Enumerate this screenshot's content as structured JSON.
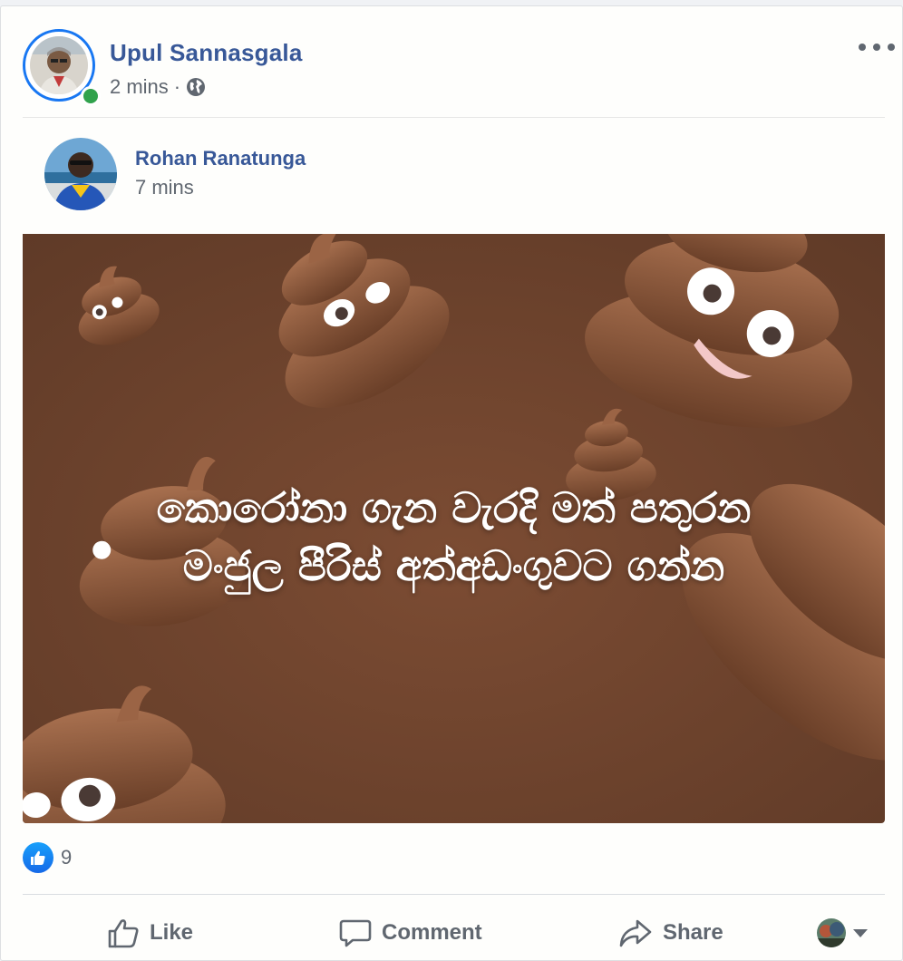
{
  "post": {
    "author": "Upul Sannasgala",
    "time": "2 mins",
    "separator": "·",
    "privacy_icon": "globe-icon",
    "online": true
  },
  "shared_post": {
    "author": "Rohan Ranatunga",
    "time": "7 mins",
    "image_caption_line1": "කොරෝනා ගැන වැරදි මත් පතුරන",
    "image_caption_line2": "මංජුල පීරිස් අත්අඩංගුවට ගන්න"
  },
  "reactions": {
    "type": "like",
    "count": "9"
  },
  "actions": {
    "like": "Like",
    "comment": "Comment",
    "share": "Share"
  },
  "colors": {
    "name_link": "#385898",
    "meta_text": "#606770",
    "accent": "#1877f2",
    "online": "#31a24c",
    "image_bg": "#6e4430"
  }
}
